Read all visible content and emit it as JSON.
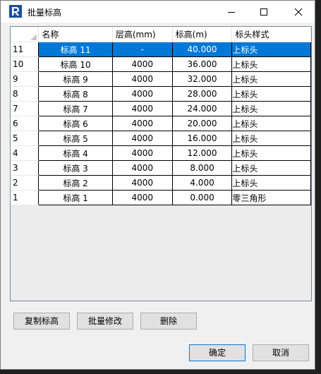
{
  "window": {
    "title": "批量标高"
  },
  "grid": {
    "columns": [
      "名称",
      "层高(mm)",
      "标高(m)",
      "标头样式"
    ],
    "rows": [
      {
        "num": "11",
        "name": "标高 11",
        "height": "-",
        "elevation": "40.000",
        "style": "上标头",
        "selected": true
      },
      {
        "num": "10",
        "name": "标高 10",
        "height": "4000",
        "elevation": "36.000",
        "style": "上标头"
      },
      {
        "num": "9",
        "name": "标高 9",
        "height": "4000",
        "elevation": "32.000",
        "style": "上标头"
      },
      {
        "num": "8",
        "name": "标高 8",
        "height": "4000",
        "elevation": "28.000",
        "style": "上标头"
      },
      {
        "num": "7",
        "name": "标高 7",
        "height": "4000",
        "elevation": "24.000",
        "style": "上标头"
      },
      {
        "num": "6",
        "name": "标高 6",
        "height": "4000",
        "elevation": "20.000",
        "style": "上标头"
      },
      {
        "num": "5",
        "name": "标高 5",
        "height": "4000",
        "elevation": "16.000",
        "style": "上标头"
      },
      {
        "num": "4",
        "name": "标高 4",
        "height": "4000",
        "elevation": "12.000",
        "style": "上标头"
      },
      {
        "num": "3",
        "name": "标高 3",
        "height": "4000",
        "elevation": "8.000",
        "style": "上标头"
      },
      {
        "num": "2",
        "name": "标高 2",
        "height": "4000",
        "elevation": "4.000",
        "style": "上标头"
      },
      {
        "num": "1",
        "name": "标高 1",
        "height": "4000",
        "elevation": "0.000",
        "style": "零三角形"
      }
    ]
  },
  "buttons": {
    "copy": "复制标高",
    "batch_edit": "批量修改",
    "delete": "删除",
    "ok": "确定",
    "cancel": "取消"
  },
  "colors": {
    "selection": "#0078d7",
    "app_icon": "#1b4f9c"
  }
}
